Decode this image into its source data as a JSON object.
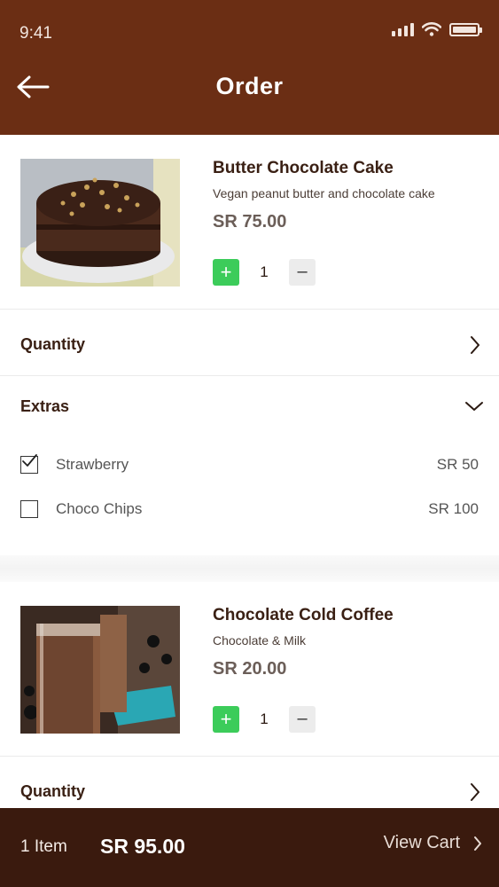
{
  "status_bar": {
    "time": "9:41"
  },
  "header": {
    "title": "Order"
  },
  "items": [
    {
      "name": "Butter Chocolate Cake",
      "description": "Vegan peanut butter and chocolate cake",
      "price": "SR 75.00",
      "quantity": "1",
      "quantity_row_label": "Quantity",
      "extras_label": "Extras",
      "extras": [
        {
          "name": "Strawberry",
          "price": "SR 50",
          "checked": true
        },
        {
          "name": "Choco Chips",
          "price": "SR 100",
          "checked": false
        }
      ]
    },
    {
      "name": "Chocolate Cold Coffee",
      "description": "Chocolate & Milk",
      "price": "SR 20.00",
      "quantity": "1",
      "quantity_row_label": "Quantity"
    }
  ],
  "footer": {
    "item_count": "1 Item",
    "total": "SR 95.00",
    "view_cart": "View Cart"
  },
  "colors": {
    "header": "#6b2e14",
    "footer": "#3a1a0e",
    "plus_button": "#3ccc5a"
  }
}
